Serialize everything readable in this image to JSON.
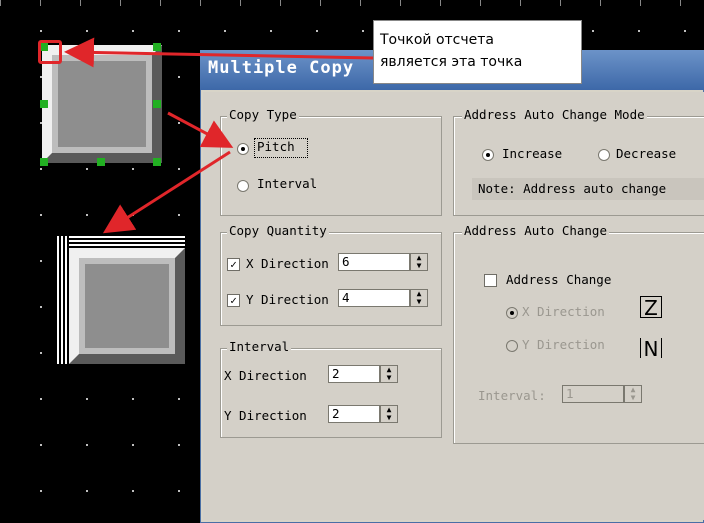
{
  "dialog": {
    "title": "Multiple Copy",
    "copy_type": {
      "legend": "Copy Type",
      "options": [
        "Pitch",
        "Interval"
      ],
      "selected": "Pitch"
    },
    "copy_quantity": {
      "legend": "Copy Quantity",
      "x_label": "X Direction",
      "x_value": "6",
      "x_checked": true,
      "y_label": "Y Direction",
      "y_value": "4",
      "y_checked": true
    },
    "interval": {
      "legend": "Interval",
      "x_label": "X Direction",
      "x_value": "2",
      "y_label": "Y Direction",
      "y_value": "2"
    },
    "address_mode": {
      "legend": "Address Auto Change Mode",
      "options": [
        "Increase",
        "Decrease"
      ],
      "selected": "Increase",
      "note": "Note: Address auto change"
    },
    "address_change": {
      "legend": "Address Auto Change",
      "checkbox_label": "Address Change",
      "x_direction": "X Direction",
      "y_direction": "Y Direction",
      "interval_label": "Interval:",
      "interval_value": "1"
    }
  },
  "callout": {
    "line1": "Точкой отсчета",
    "line2": "является эта точка"
  },
  "colors": {
    "arrow": "#e0262a",
    "handle": "#22b022",
    "title_bar": "#3d68a8"
  }
}
